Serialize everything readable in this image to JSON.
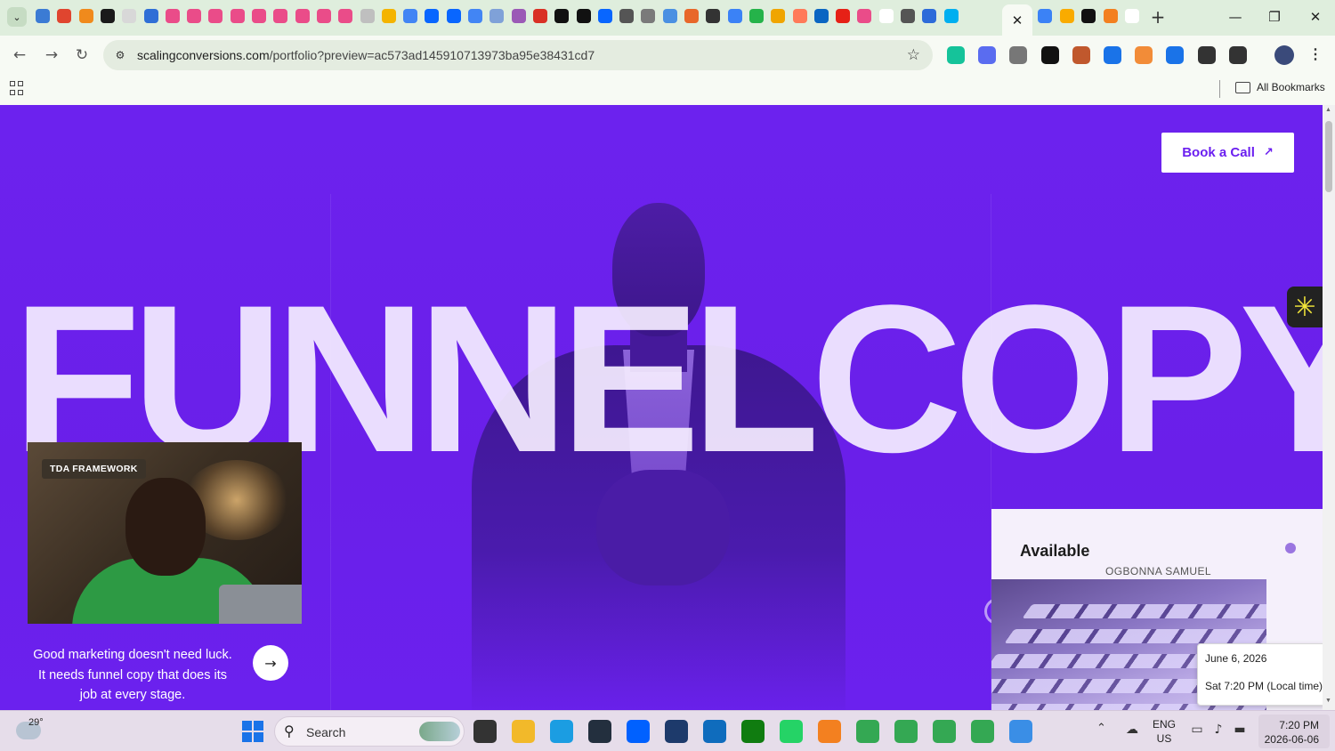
{
  "browser": {
    "url_host": "scalingconversions.com",
    "url_path": "/portfolio?preview=ac573ad145910713973ba95e38431cd7",
    "active_tab_close": "✕",
    "new_tab": "+",
    "window_controls": [
      "—",
      "❐",
      "✕"
    ],
    "bookmarks_label": "All Bookmarks",
    "tab_favicons": [
      {
        "icon": "tab-search-icon",
        "color": "#c6dcc3"
      },
      {
        "icon": "chart-icon",
        "color": "#3b7bd4"
      },
      {
        "icon": "pages-icon",
        "color": "#e0452f"
      },
      {
        "icon": "swirl-icon",
        "color": "#f08a1c"
      },
      {
        "icon": "pulse-icon",
        "color": "#1a1a1a"
      },
      {
        "icon": "feather-icon",
        "color": "#d8d8d8"
      },
      {
        "icon": "mountain-icon",
        "color": "#2f6fd6"
      },
      {
        "icon": "dribbble-icon",
        "color": "#ea4c89"
      },
      {
        "icon": "dribbble-icon",
        "color": "#ea4c89"
      },
      {
        "icon": "dribbble-icon",
        "color": "#ea4c89"
      },
      {
        "icon": "dribbble-icon",
        "color": "#ea4c89"
      },
      {
        "icon": "dribbble-icon",
        "color": "#ea4c89"
      },
      {
        "icon": "dribbble-icon",
        "color": "#ea4c89"
      },
      {
        "icon": "dribbble-icon",
        "color": "#ea4c89"
      },
      {
        "icon": "dribbble-icon",
        "color": "#ea4c89"
      },
      {
        "icon": "dribbble-icon",
        "color": "#ea4c89"
      },
      {
        "icon": "font-icon",
        "color": "#bfbfbf"
      },
      {
        "icon": "drive-icon",
        "color": "#f4b400"
      },
      {
        "icon": "docs-icon",
        "color": "#4285f4"
      },
      {
        "icon": "meta-icon",
        "color": "#0866ff"
      },
      {
        "icon": "meta-icon",
        "color": "#0866ff"
      },
      {
        "icon": "docs-icon",
        "color": "#4285f4"
      },
      {
        "icon": "swirl-icon",
        "color": "#7fa1d8"
      },
      {
        "icon": "mail-icon",
        "color": "#9b59b6"
      },
      {
        "icon": "gmail-icon",
        "color": "#d93025"
      },
      {
        "icon": "tiktok-icon",
        "color": "#111111"
      },
      {
        "icon": "threads-icon",
        "color": "#111111"
      },
      {
        "icon": "meta-icon",
        "color": "#0866ff"
      },
      {
        "icon": "globe-icon",
        "color": "#555555"
      },
      {
        "icon": "avatar-icon",
        "color": "#7a7a7a"
      },
      {
        "icon": "bird-icon",
        "color": "#4a90e2"
      },
      {
        "icon": "spark-icon",
        "color": "#e8672a"
      },
      {
        "icon": "chatgpt-icon",
        "color": "#333333"
      },
      {
        "icon": "shield-icon",
        "color": "#3b82f6"
      },
      {
        "icon": "chat-icon",
        "color": "#25b34a"
      },
      {
        "icon": "cloud-icon",
        "color": "#f0a500"
      },
      {
        "icon": "hubspot-icon",
        "color": "#ff7a59"
      },
      {
        "icon": "linkedin-icon",
        "color": "#0a66c2"
      },
      {
        "icon": "youtube-icon",
        "color": "#e62117"
      },
      {
        "icon": "dribbble-icon",
        "color": "#ea4c89"
      },
      {
        "icon": "google-icon",
        "color": "#ffffff"
      },
      {
        "icon": "speaker-icon",
        "color": "#555555"
      },
      {
        "icon": "cube-icon",
        "color": "#2d6bd9"
      },
      {
        "icon": "skype-icon",
        "color": "#00aff0"
      }
    ],
    "tab_favicons_after": [
      {
        "icon": "diamond-icon",
        "color": "#3b82f6"
      },
      {
        "icon": "analytics-icon",
        "color": "#f9ab00"
      },
      {
        "icon": "notes-icon",
        "color": "#111111"
      },
      {
        "icon": "cloudflare-icon",
        "color": "#f38020"
      },
      {
        "icon": "google-icon",
        "color": "#ffffff"
      }
    ],
    "extensions": [
      {
        "icon": "grammarly-icon",
        "color": "#15c39a"
      },
      {
        "icon": "broadcast-icon",
        "color": "#5a6cf0"
      },
      {
        "icon": "puzzle-piece-icon",
        "color": "#777777"
      },
      {
        "icon": "asterisk-icon",
        "color": "#111111"
      },
      {
        "icon": "g-icon",
        "color": "#c0582d"
      },
      {
        "icon": "eye-icon",
        "color": "#1a73e8"
      },
      {
        "icon": "hexagon-icon",
        "color": "#f28c38"
      },
      {
        "icon": "tag-icon",
        "color": "#1a73e8"
      },
      {
        "icon": "extensions-icon",
        "color": "#333333"
      },
      {
        "icon": "media-icon",
        "color": "#333333"
      }
    ]
  },
  "page": {
    "headline": "FUNNELCOPY",
    "cta_label": "Book a Call",
    "cta_arrow": "↗",
    "photo_tag": "TDA FRAMEWORK",
    "tagline_lines": [
      "Good marketing doesn't need luck.",
      "It needs funnel copy that does its",
      "job at every stage."
    ],
    "next_arrow": "→",
    "availability": {
      "title": "Available",
      "name": "OGBONNA SAMUEL"
    },
    "side_extension_glyph": "✳",
    "tooltip": {
      "date": "June 6, 2026",
      "local": "Sat 7:20 PM (Local time)"
    },
    "colors": {
      "brand_purple": "#6b1ff0",
      "headline_fill": "#f4ecff",
      "card_bg": "#f5f0fb"
    }
  },
  "taskbar": {
    "weather_temp": "29°",
    "search_label": "Search",
    "lang_line1": "ENG",
    "lang_line2": "US",
    "time": "7:20 PM",
    "date": "2026-06-06",
    "apps": [
      {
        "icon": "windows-start-icon",
        "color": "#1a73e8"
      },
      {
        "icon": "task-view-icon",
        "color": "#333333"
      },
      {
        "icon": "file-explorer-icon",
        "color": "#f2b92a"
      },
      {
        "icon": "edge-icon",
        "color": "#1b9de2"
      },
      {
        "icon": "amazon-icon",
        "color": "#232f3e"
      },
      {
        "icon": "dropbox-icon",
        "color": "#0061ff"
      },
      {
        "icon": "b-app-icon",
        "color": "#1d3a6b"
      },
      {
        "icon": "outlook-icon",
        "color": "#0f6cbd"
      },
      {
        "icon": "xbox-icon",
        "color": "#107c10"
      },
      {
        "icon": "whatsapp-icon",
        "color": "#25d366"
      },
      {
        "icon": "cloud-app-icon",
        "color": "#f38020"
      },
      {
        "icon": "chrome-icon",
        "color": "#34a853"
      },
      {
        "icon": "chrome-icon",
        "color": "#34a853"
      },
      {
        "icon": "chrome-icon",
        "color": "#34a853"
      },
      {
        "icon": "chrome-icon",
        "color": "#34a853"
      },
      {
        "icon": "notepad-icon",
        "color": "#3a8ee6"
      }
    ]
  }
}
